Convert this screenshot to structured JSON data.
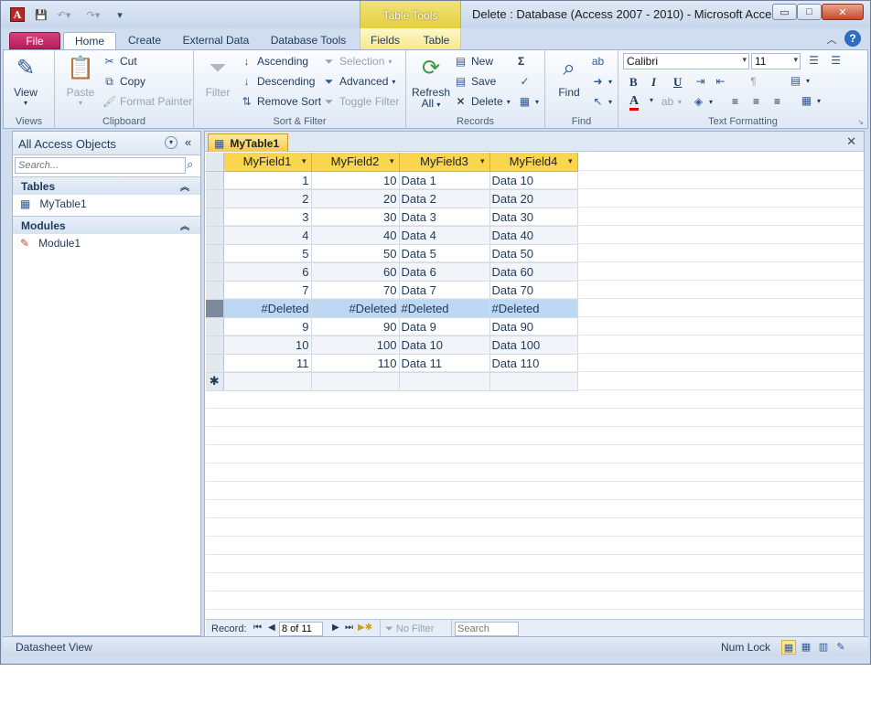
{
  "window": {
    "title": "Delete : Database (Access 2007 - 2010)  -  Microsoft Access",
    "app_icon_letter": "A",
    "context_group": "Table Tools",
    "controls": {
      "minimize": "▭",
      "maximize": "□",
      "close": "✕"
    }
  },
  "ribbon_tabs": [
    "File",
    "Home",
    "Create",
    "External Data",
    "Database Tools",
    "Fields",
    "Table"
  ],
  "ribbon": {
    "views": {
      "label": "Views",
      "view": "View"
    },
    "clipboard": {
      "label": "Clipboard",
      "paste": "Paste",
      "cut": "Cut",
      "copy": "Copy",
      "format_painter": "Format Painter"
    },
    "sort_filter": {
      "label": "Sort & Filter",
      "filter": "Filter",
      "ascending": "Ascending",
      "descending": "Descending",
      "remove_sort": "Remove Sort",
      "selection": "Selection",
      "advanced": "Advanced",
      "toggle_filter": "Toggle Filter"
    },
    "records": {
      "label": "Records",
      "refresh": "Refresh",
      "refresh_sub": "All",
      "new": "New",
      "save": "Save",
      "delete": "Delete",
      "totals_glyph": "Σ"
    },
    "find": {
      "label": "Find",
      "find": "Find"
    },
    "text_formatting": {
      "label": "Text Formatting",
      "font": "Calibri",
      "size": "11",
      "bold": "B",
      "italic": "I",
      "underline": "U"
    }
  },
  "nav_pane": {
    "title": "All Access Objects",
    "search_placeholder": "Search...",
    "sections": [
      {
        "title": "Tables",
        "items": [
          "MyTable1"
        ]
      },
      {
        "title": "Modules",
        "items": [
          "Module1"
        ]
      }
    ]
  },
  "document": {
    "tab": "MyTable1",
    "columns": [
      "MyField1",
      "MyField2",
      "MyField3",
      "MyField4"
    ],
    "rows": [
      [
        "1",
        "10",
        "Data 1",
        "Data 10"
      ],
      [
        "2",
        "20",
        "Data 2",
        "Data 20"
      ],
      [
        "3",
        "30",
        "Data 3",
        "Data 30"
      ],
      [
        "4",
        "40",
        "Data 4",
        "Data 40"
      ],
      [
        "5",
        "50",
        "Data 5",
        "Data 50"
      ],
      [
        "6",
        "60",
        "Data 6",
        "Data 60"
      ],
      [
        "7",
        "70",
        "Data 7",
        "Data 70"
      ],
      [
        "#Deleted",
        "#Deleted",
        "#Deleted",
        "#Deleted"
      ],
      [
        "9",
        "90",
        "Data 9",
        "Data 90"
      ],
      [
        "10",
        "100",
        "Data 10",
        "Data 100"
      ],
      [
        "11",
        "110",
        "Data 11",
        "Data 110"
      ]
    ],
    "new_row_marker": "✱"
  },
  "record_nav": {
    "label": "Record:",
    "position": "8 of 11",
    "filter_status": "No Filter",
    "search": "Search"
  },
  "status_bar": {
    "left": "Datasheet View",
    "num_lock": "Num Lock"
  }
}
